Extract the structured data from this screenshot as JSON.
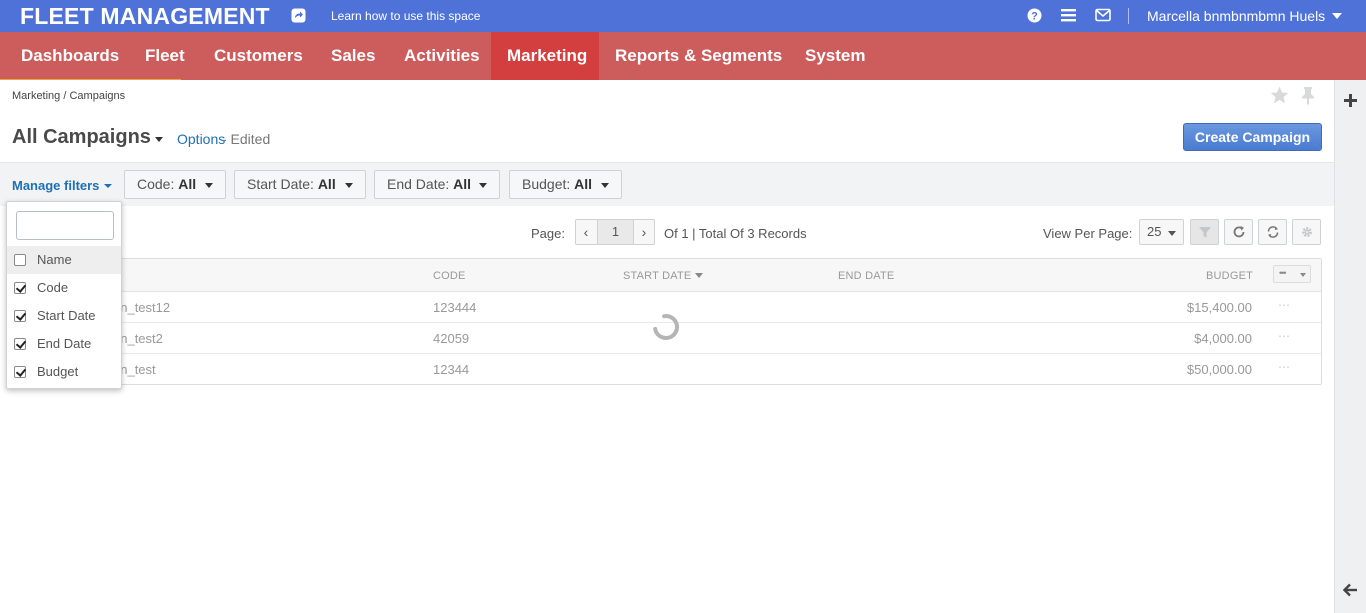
{
  "topbar": {
    "brand": "FLEET MANAGEMENT",
    "learn_link": "Learn how to use this space",
    "user_name": "Marcella bnmbnmbmn Huels"
  },
  "nav": {
    "items": [
      "Dashboards",
      "Fleet",
      "Customers",
      "Sales",
      "Activities",
      "Marketing",
      "Reports & Segments",
      "System"
    ],
    "active": "Marketing"
  },
  "breadcrumb": {
    "parent": "Marketing",
    "separator": "/",
    "current": "Campaigns"
  },
  "page": {
    "title": "All Campaigns",
    "options_label": "Options",
    "edited_label": "- Edited",
    "create_button": "Create Campaign"
  },
  "filters": {
    "manage_label": "Manage filters",
    "items": [
      {
        "label": "Code:",
        "value": "All"
      },
      {
        "label": "Start Date:",
        "value": "All"
      },
      {
        "label": "End Date:",
        "value": "All"
      },
      {
        "label": "Budget:",
        "value": "All"
      }
    ]
  },
  "pagination": {
    "page_label": "Page:",
    "current_page": "1",
    "of_text": "Of 1 |  Total Of 3 Records",
    "view_per_page_label": "View Per Page:",
    "per_page": "25"
  },
  "grid": {
    "columns": [
      "CODE",
      "START DATE",
      "END DATE",
      "BUDGET"
    ],
    "rows": [
      {
        "name": "gn_test12",
        "code": "123444",
        "start_date": "",
        "end_date": "",
        "budget": "$15,400.00"
      },
      {
        "name": "gn_test2",
        "code": "42059",
        "start_date": "",
        "end_date": "",
        "budget": "$4,000.00"
      },
      {
        "name": "gn_test",
        "code": "12344",
        "start_date": "",
        "end_date": "",
        "budget": "$50,000.00"
      }
    ]
  },
  "filter_dropdown": {
    "search_value": "",
    "options": [
      {
        "label": "Name",
        "checked": false
      },
      {
        "label": "Code",
        "checked": true
      },
      {
        "label": "Start Date",
        "checked": true
      },
      {
        "label": "End Date",
        "checked": true
      },
      {
        "label": "Budget",
        "checked": true
      }
    ]
  },
  "colors": {
    "topbar": "#4f72d9",
    "nav": "#cd5c5c",
    "nav_active": "#d33f3f",
    "nav_underline": "#f0a43a",
    "primary_button": "#4a7bd0",
    "link": "#1f6fb5"
  }
}
